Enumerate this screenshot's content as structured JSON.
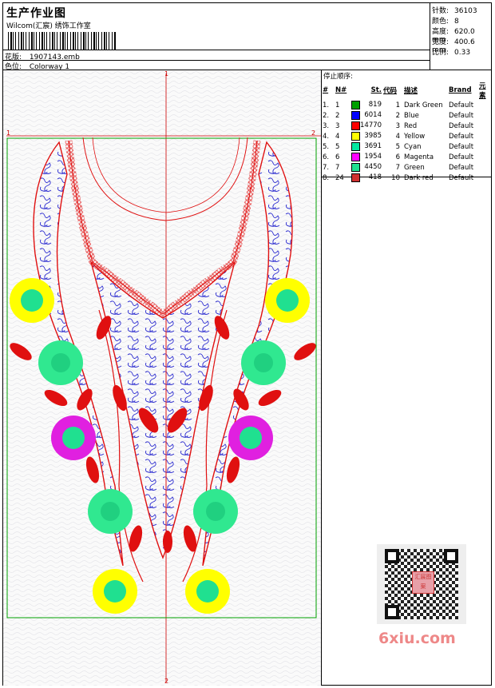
{
  "header": {
    "title": "生产作业图",
    "studio": "Wilcom(汇宸) 绣饰工作室",
    "design_label": "花版:",
    "design_value": "1907143.emb",
    "colorway_label": "色位:",
    "colorway_value": "Colorway 1"
  },
  "stats": [
    {
      "label": "针数:",
      "value": "36103"
    },
    {
      "label": "颜色:",
      "value": "8"
    },
    {
      "label": "高度:",
      "value": "620.0 mm"
    },
    {
      "label": "宽度:",
      "value": "400.6 mm"
    },
    {
      "label": "比例:",
      "value": "0.33"
    }
  ],
  "legend": {
    "title": "停止顺序:",
    "columns": [
      "#",
      "N#",
      "St.",
      "代码",
      "描述",
      "Brand",
      "元素"
    ],
    "rows": [
      {
        "idx": "1.",
        "n": "1",
        "color": "#00a000",
        "st": "819",
        "code": "1",
        "desc": "Dark Green",
        "brand": "Default"
      },
      {
        "idx": "2.",
        "n": "2",
        "color": "#0000ff",
        "st": "6014",
        "code": "2",
        "desc": "Blue",
        "brand": "Default"
      },
      {
        "idx": "3.",
        "n": "3",
        "color": "#ff0000",
        "st": "14770",
        "code": "3",
        "desc": "Red",
        "brand": "Default"
      },
      {
        "idx": "4.",
        "n": "4",
        "color": "#ffff00",
        "st": "3985",
        "code": "4",
        "desc": "Yellow",
        "brand": "Default"
      },
      {
        "idx": "5.",
        "n": "5",
        "color": "#00e8a0",
        "st": "3691",
        "code": "5",
        "desc": "Cyan",
        "brand": "Default"
      },
      {
        "idx": "6.",
        "n": "6",
        "color": "#ff00ff",
        "st": "1954",
        "code": "6",
        "desc": "Magenta",
        "brand": "Default"
      },
      {
        "idx": "7.",
        "n": "7",
        "color": "#20e090",
        "st": "4450",
        "code": "7",
        "desc": "Green",
        "brand": "Default"
      },
      {
        "idx": "8.",
        "n": "24",
        "color": "#d03030",
        "st": "418",
        "code": "10",
        "desc": "Dark red",
        "brand": "Default"
      }
    ]
  },
  "markers": {
    "m1": "1",
    "m2": "2"
  },
  "watermark": "6xiu.com",
  "qr_seal": "汇宸图案",
  "colors": {
    "red": "#e01010",
    "blue": "#2020c0",
    "yellow": "#ffff00",
    "green": "#30e890",
    "magenta": "#e020e0",
    "frame_green": "#00a000"
  }
}
